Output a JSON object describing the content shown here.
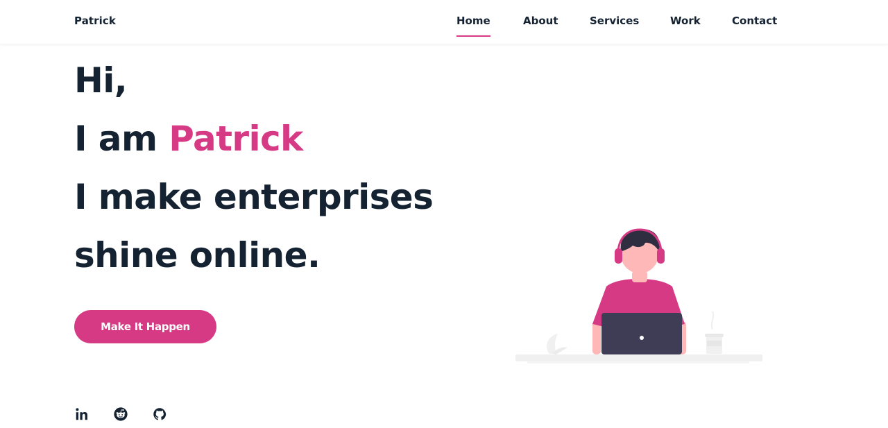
{
  "colors": {
    "accent": "#d63a85",
    "text": "#152231",
    "laptop": "#3f3d56",
    "skin": "#ffb8b8",
    "desk": "#f0f0f0"
  },
  "header": {
    "logo": "Patrick",
    "nav": [
      {
        "label": "Home",
        "active": true
      },
      {
        "label": "About",
        "active": false
      },
      {
        "label": "Services",
        "active": false
      },
      {
        "label": "Work",
        "active": false
      },
      {
        "label": "Contact",
        "active": false
      }
    ]
  },
  "hero": {
    "line1": "Hi,",
    "line2_prefix": "I am ",
    "name": "Patrick",
    "line3": "I make enterprises",
    "line4": "shine online.",
    "cta_label": "Make It Happen"
  },
  "social": [
    {
      "icon": "linkedin-icon"
    },
    {
      "icon": "reddit-icon"
    },
    {
      "icon": "github-icon"
    }
  ]
}
